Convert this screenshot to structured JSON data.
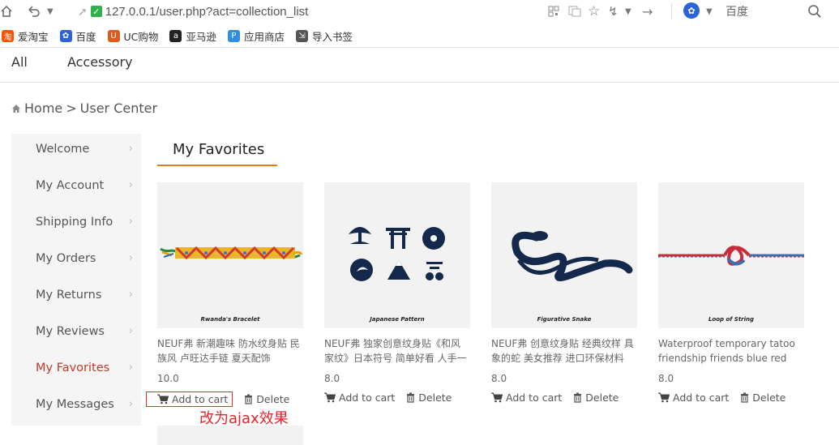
{
  "browser": {
    "url": "127.0.0.1/user.php?act=collection_list",
    "search_engine": "百度",
    "bookmarks": [
      {
        "label": "爱淘宝",
        "icon": "taobao-icon",
        "color": "#ff5000"
      },
      {
        "label": "百度",
        "icon": "baidu-paw-icon",
        "color": "#2d63d9"
      },
      {
        "label": "UC购物",
        "icon": "uc-icon",
        "color": "#e05a1c"
      },
      {
        "label": "亚马逊",
        "icon": "amazon-icon",
        "color": "#222222"
      },
      {
        "label": "应用商店",
        "icon": "app-store-icon",
        "color": "#2e8fe0"
      },
      {
        "label": "导入书签",
        "icon": "import-icon",
        "color": "#555555"
      }
    ]
  },
  "nav": {
    "items": [
      "All",
      "Accessory"
    ]
  },
  "breadcrumb": {
    "home": "Home",
    "separator": ">",
    "current": "User Center"
  },
  "sidebar": {
    "items": [
      "Welcome",
      "My Account",
      "Shipping Info",
      "My Orders",
      "My Returns",
      "My Reviews",
      "My Favorites",
      "My Messages"
    ],
    "active": "My Favorites",
    "active_color": "#c0392b"
  },
  "favorites": {
    "title": "My Favorites",
    "accent": "#e07b20",
    "add_label": "Add to cart",
    "delete_label": "Delete",
    "items": [
      {
        "name": "NEUF弗 新潮趣味 防水纹身贴 民族风 卢旺达手链 夏天配饰",
        "price": "10.0",
        "caption": "Rwanda's Bracelet"
      },
      {
        "name": "NEUF弗 独家创意纹身贴《和风家纹》日本符号 简单好看 人手一个",
        "price": "8.0",
        "caption": "Japanese Pattern"
      },
      {
        "name": "NEUF弗 创意纹身贴 经典纹样 具象的蛇 美女推荐 进口环保材料",
        "price": "8.0",
        "caption": "Figurative Snake"
      },
      {
        "name": "Waterproof temporary tatoo friendship friends blue red",
        "price": "8.0",
        "caption": "Loop of String"
      }
    ]
  },
  "annotation": "改为ajax效果"
}
